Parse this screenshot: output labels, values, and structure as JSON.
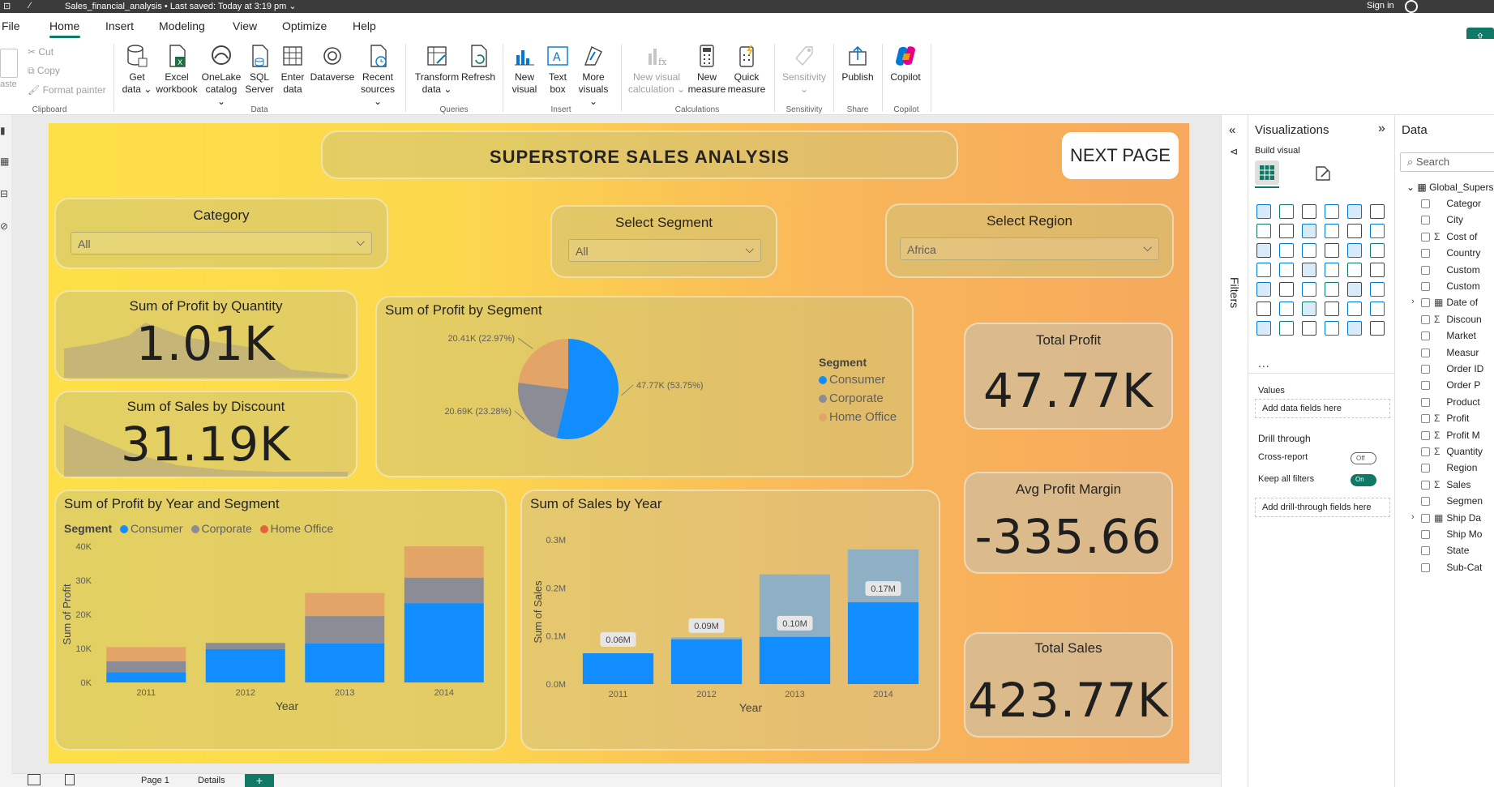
{
  "titlebar": {
    "title": "Sales_financial_analysis  •  Last saved: Today at 3:19 pm  ⌄",
    "signin": "Sign in"
  },
  "menu": {
    "tabs": [
      "File",
      "Home",
      "Insert",
      "Modeling",
      "View",
      "Optimize",
      "Help"
    ],
    "active": "Home"
  },
  "ribbon": {
    "clipboard": {
      "paste": "aste",
      "cut": "Cut",
      "copy": "Copy",
      "format_painter": "Format painter",
      "label": "Clipboard"
    },
    "data": {
      "get_data": [
        "Get",
        "data ⌄"
      ],
      "excel": [
        "Excel",
        "workbook"
      ],
      "onelake": [
        "OneLake",
        "catalog ⌄"
      ],
      "sql": [
        "SQL",
        "Server"
      ],
      "enter": [
        "Enter",
        "data"
      ],
      "dataverse": [
        "Dataverse",
        ""
      ],
      "recent": [
        "Recent",
        "sources ⌄"
      ],
      "label": "Data"
    },
    "queries": {
      "transform": [
        "Transform",
        "data ⌄"
      ],
      "refresh": [
        "Refresh",
        ""
      ],
      "label": "Queries"
    },
    "insert": {
      "new_visual": [
        "New",
        "visual"
      ],
      "text_box": [
        "Text",
        "box"
      ],
      "more_visuals": [
        "More",
        "visuals ⌄"
      ],
      "label": "Insert"
    },
    "calculations": {
      "new_visual_calc": [
        "New visual",
        "calculation ⌄"
      ],
      "new_measure": [
        "New",
        "measure"
      ],
      "quick_measure": [
        "Quick",
        "measure"
      ],
      "label": "Calculations"
    },
    "sensitivity": {
      "btn": [
        "Sensitivity",
        "⌄"
      ],
      "label": "Sensitivity"
    },
    "share": {
      "publish": [
        "Publish",
        ""
      ],
      "label": "Share"
    },
    "copilot": {
      "btn": [
        "Copilot",
        ""
      ],
      "label": "Copilot"
    }
  },
  "report": {
    "title": "SUPERSTORE SALES ANALYSIS",
    "next_button": "NEXT PAGE",
    "slicers": [
      {
        "title": "Category",
        "value": "All"
      },
      {
        "title": "Select Segment",
        "value": "All"
      },
      {
        "title": "Select Region",
        "value": "Africa"
      }
    ],
    "kpis": {
      "profit_by_qty": {
        "title": "Sum of Profit by Quantity",
        "value": "1.01K"
      },
      "sales_by_discount": {
        "title": "Sum of Sales by Discount",
        "value": "31.19K"
      },
      "total_profit": {
        "title": "Total Profit",
        "value": "47.77K"
      },
      "avg_margin": {
        "title": "Avg Profit Margin",
        "value": "-335.66"
      },
      "total_sales": {
        "title": "Total Sales",
        "value": "423.77K"
      }
    },
    "colors": {
      "consumer": "#118dff",
      "corporate": "#8c8c96",
      "home_office": "#e3a468",
      "sales_light": "#8fb0c4"
    }
  },
  "chart_data": [
    {
      "type": "pie",
      "title": "Sum of Profit by Segment",
      "legend_title": "Segment",
      "legend_position": "right",
      "categories": [
        "Consumer",
        "Corporate",
        "Home Office"
      ],
      "values": [
        47.77,
        20.69,
        20.41
      ],
      "labels": [
        "47.77K (53.75%)",
        "20.69K (23.28%)",
        "20.41K (22.97%)"
      ]
    },
    {
      "type": "bar",
      "stacked": true,
      "title": "Sum of Profit by Year and Segment",
      "legend_title": "Segment",
      "legend_position": "top-left",
      "categories": [
        "2011",
        "2012",
        "2013",
        "2014"
      ],
      "xlabel": "Year",
      "ylabel": "Sum of Profit",
      "ylim": [
        0,
        40000
      ],
      "yticks": [
        "0K",
        "10K",
        "20K",
        "30K",
        "40K"
      ],
      "series": [
        {
          "name": "Consumer",
          "values": [
            3000,
            9800,
            11500,
            23300
          ]
        },
        {
          "name": "Corporate",
          "values": [
            3200,
            1800,
            8000,
            7500
          ]
        },
        {
          "name": "Home Office",
          "values": [
            4200,
            0,
            6800,
            9200
          ]
        }
      ]
    },
    {
      "type": "bar",
      "stacked": true,
      "title": "Sum of Sales by Year",
      "categories": [
        "2011",
        "2012",
        "2013",
        "2014"
      ],
      "xlabel": "Year",
      "ylabel": "Sum of Sales",
      "ylim": [
        0,
        0.3
      ],
      "yticks": [
        "0.0M",
        "0.1M",
        "0.2M",
        "0.3M"
      ],
      "series": [
        {
          "values": [
            0.064,
            0.093,
            0.098,
            0.17
          ]
        },
        {
          "values": [
            0.063,
            0.097,
            0.228,
            0.28
          ]
        }
      ],
      "data_labels": [
        "0.06M",
        "0.09M",
        "0.10M",
        "0.17M"
      ]
    }
  ],
  "filters": {
    "label": "Filters"
  },
  "visualizations": {
    "title": "Visualizations",
    "build_visual": "Build visual",
    "more": "...",
    "values_label": "Values",
    "values_placeholder": "Add data fields here",
    "drill_label": "Drill through",
    "cross_report": "Cross-report",
    "cross_report_state": "Off",
    "keep_filters": "Keep all filters",
    "keep_filters_state": "On",
    "drill_placeholder": "Add drill-through fields here"
  },
  "data_pane": {
    "title": "Data",
    "search_placeholder": "Search",
    "table": "Global_Supers",
    "fields": [
      {
        "name": "Categor",
        "sigma": false
      },
      {
        "name": "City",
        "sigma": false
      },
      {
        "name": "Cost of",
        "sigma": true
      },
      {
        "name": "Country",
        "sigma": false
      },
      {
        "name": "Custom",
        "sigma": false
      },
      {
        "name": "Custom",
        "sigma": false
      },
      {
        "name": "Date of",
        "sigma": false,
        "expandable": true
      },
      {
        "name": "Discoun",
        "sigma": true
      },
      {
        "name": "Market",
        "sigma": false
      },
      {
        "name": "Measur",
        "sigma": false
      },
      {
        "name": "Order ID",
        "sigma": false
      },
      {
        "name": "Order P",
        "sigma": false
      },
      {
        "name": "Product",
        "sigma": false
      },
      {
        "name": "Profit",
        "sigma": true
      },
      {
        "name": "Profit M",
        "sigma": true
      },
      {
        "name": "Quantity",
        "sigma": true
      },
      {
        "name": "Region",
        "sigma": false
      },
      {
        "name": "Sales",
        "sigma": true
      },
      {
        "name": "Segmen",
        "sigma": false
      },
      {
        "name": "Ship Da",
        "sigma": false,
        "expandable": true
      },
      {
        "name": "Ship Mo",
        "sigma": false
      },
      {
        "name": "State",
        "sigma": false
      },
      {
        "name": "Sub-Cat",
        "sigma": false
      }
    ]
  },
  "pages": {
    "tabs": [
      "Page 1",
      "Details"
    ],
    "add": "+"
  }
}
